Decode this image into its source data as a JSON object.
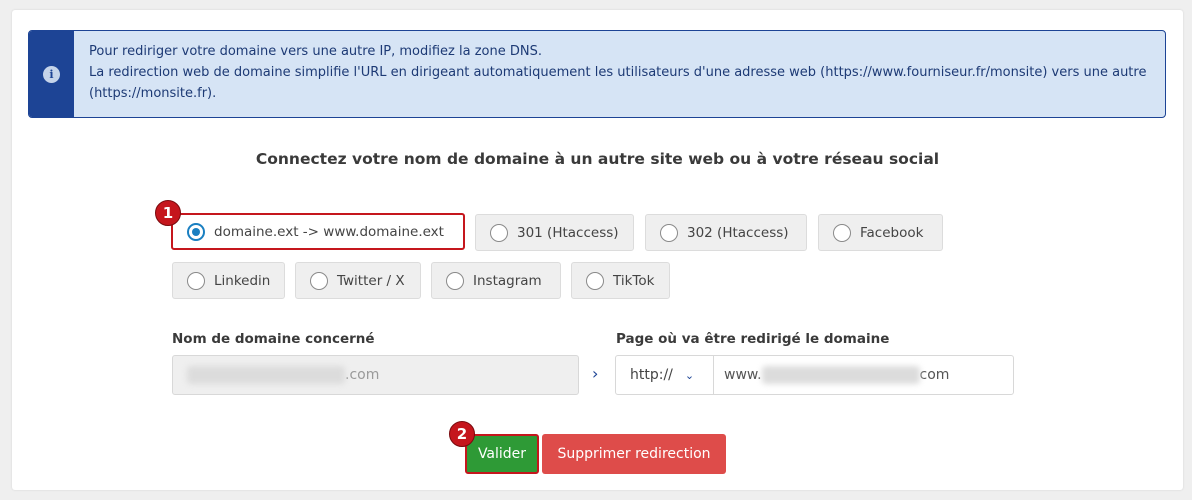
{
  "alert": {
    "icon": "info-icon",
    "line1": "Pour rediriger votre domaine vers une autre IP, modifiez la zone DNS.",
    "line2": "La redirection web de domaine simplifie l'URL en dirigeant automatiquement les utilisateurs d'une adresse web (https://www.fourniseur.fr/monsite) vers une autre (https://monsite.fr)."
  },
  "title": "Connectez votre nom de domaine à un autre site web ou à votre réseau social",
  "options": [
    {
      "label": "domaine.ext -> www.domaine.ext",
      "selected": true
    },
    {
      "label": "301 (Htaccess)",
      "selected": false
    },
    {
      "label": "302 (Htaccess)",
      "selected": false
    },
    {
      "label": "Facebook",
      "selected": false
    },
    {
      "label": "Linkedin",
      "selected": false
    },
    {
      "label": "Twitter / X",
      "selected": false
    },
    {
      "label": "Instagram",
      "selected": false
    },
    {
      "label": "TikTok",
      "selected": false
    }
  ],
  "badges": {
    "first": "1",
    "second": "2"
  },
  "form": {
    "source_label": "Nom de domaine concerné",
    "source_value_suffix": ".com",
    "target_label": "Page où va être redirigé le domaine",
    "protocol": "http://",
    "target_prefix": "www.",
    "target_suffix": "com",
    "arrow": "›"
  },
  "buttons": {
    "validate": "Valider",
    "delete": "Supprimer redirection"
  },
  "colors": {
    "alert_dark": "#1d4495",
    "alert_bg": "#d6e4f5",
    "highlight": "#c5161d",
    "validate": "#2e9a36",
    "delete": "#de4c4a",
    "radio_selected": "#1a7fc1"
  }
}
